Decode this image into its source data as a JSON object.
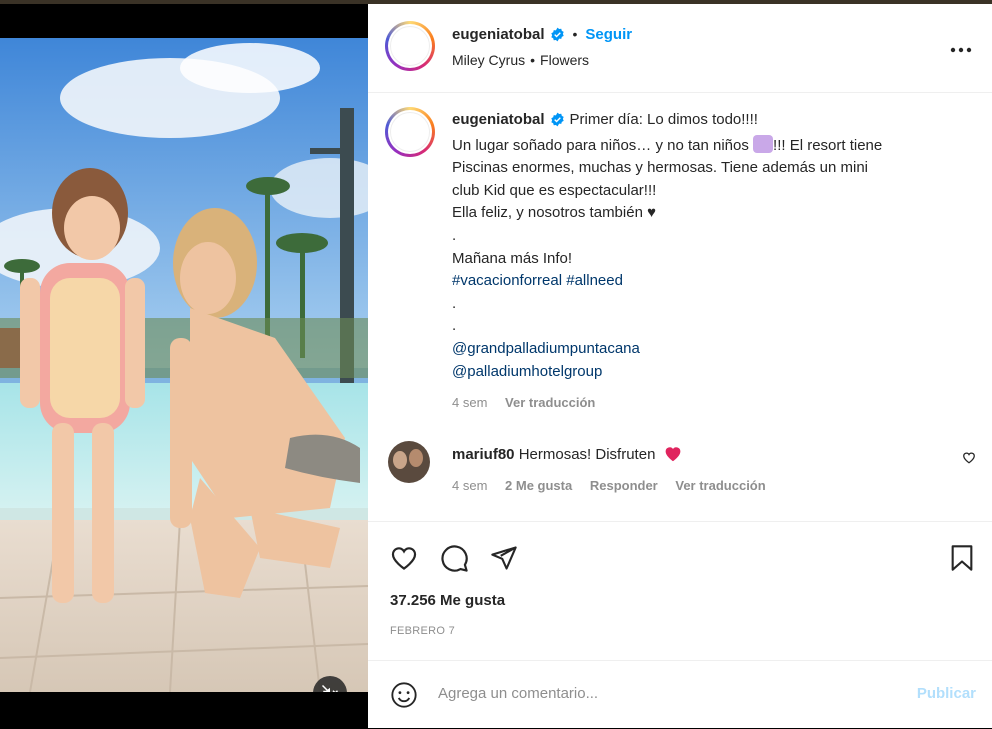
{
  "post": {
    "username": "eugeniatobal",
    "follow_label": "Seguir",
    "music_artist": "Miley Cyrus",
    "music_song": "Flowers",
    "music_separator": "•",
    "header_separator": "•"
  },
  "caption": {
    "username": "eugeniatobal",
    "line1": "Primer día: Lo dimos todo!!!!",
    "line2a": "Un lugar soñado para niños… y no tan niños ",
    "line2b": "!!! El resort tiene",
    "line3": "Piscinas enormes, muchas y hermosas. Tiene además un mini",
    "line4": "club Kid que es espectacular!!!",
    "line5": "Ella feliz, y nosotros también ♥",
    "line6": ".",
    "line7": "Mañana más Info!",
    "hashtag1": "#vacacionforreal",
    "hashtag2": "#allneed",
    "line9": ".",
    "line10": ".",
    "mention1": "@grandpalladiumpuntacana",
    "mention2": "@palladiumhotelgroup",
    "time": "4 sem",
    "translate": "Ver traducción"
  },
  "comment": {
    "username": "mariuf80",
    "text": "Hermosas! Disfruten",
    "time": "4 sem",
    "likes": "2 Me gusta",
    "reply": "Responder",
    "translate": "Ver traducción"
  },
  "stats": {
    "likes": "37.256 Me gusta",
    "date": "FEBRERO 7"
  },
  "composer": {
    "placeholder": "Agrega un comentario...",
    "publish": "Publicar"
  },
  "icons": {
    "verified": "verified-badge-icon",
    "more": "more-options-icon",
    "like": "heart-icon",
    "comment": "comment-bubble-icon",
    "share": "paper-plane-icon",
    "save": "bookmark-icon",
    "emoji": "emoji-icon",
    "mute": "speaker-muted-icon",
    "comment_like": "heart-small-icon"
  },
  "colors": {
    "accent": "#0095f6",
    "hashtag": "#00376b",
    "muted": "#8e8e8e",
    "heart_red": "#e0245e"
  }
}
